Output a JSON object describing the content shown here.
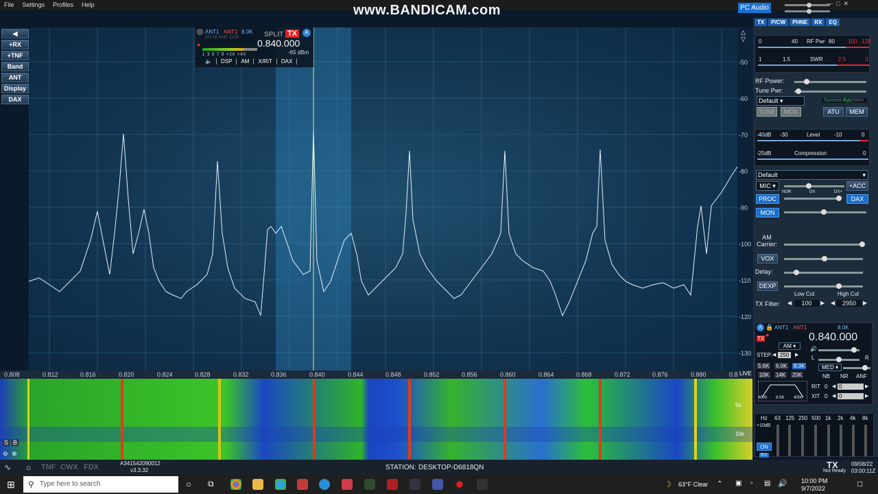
{
  "menu": [
    "File",
    "Settings",
    "Profiles",
    "Help"
  ],
  "watermark": "www.BANDICAM.com",
  "pc_audio": "PC Audio",
  "left_buttons": [
    "+RX",
    "+TNF",
    "Band",
    "ANT",
    "Display",
    "DAX"
  ],
  "slice": {
    "ant_rx": "ANT1",
    "ant_tx": "ANT1",
    "bandwidth": "8.0K",
    "split": "SPLIT",
    "tx": "TX",
    "letter": "A",
    "call": "N3 NI ANF QSK",
    "frequency": "0.840.000",
    "dbm": "-65 dBm",
    "smeter_scale": "1 3 5 7 9 +20 +40",
    "tabs": [
      "DSP",
      "AM",
      "X/RIT",
      "DAX"
    ]
  },
  "db_labels": [
    "-50",
    "-60",
    "-70",
    "-80",
    "-90",
    "-100",
    "-110",
    "-120",
    "-130"
  ],
  "freq_labels": [
    "0.808",
    "0.812",
    "0.816",
    "0.820",
    "0.824",
    "0.828",
    "0.832",
    "0.836",
    "0.840",
    "0.844",
    "0.848",
    "0.852",
    "0.856",
    "0.860",
    "0.864",
    "0.868",
    "0.872",
    "0.876",
    "0.880",
    "0.8"
  ],
  "live": "LIVE",
  "wf_labels": [
    "5s",
    "10s"
  ],
  "right": {
    "tabs": [
      "TX",
      "P/CW",
      "PHNE",
      "RX",
      "EQ"
    ],
    "rfpwr_scale": [
      "0",
      "40",
      "RF Pwr",
      "80",
      "100",
      "120"
    ],
    "swr_scale": [
      "1",
      "1.5",
      "SWR",
      "2.5",
      "3"
    ],
    "rf_power": "RF Power:",
    "tune_pwr": "Tune Pwr:",
    "profile": "Default",
    "tune": "TUNE",
    "mox": "MOX",
    "success": "Success",
    "byp": "Byp",
    "mem_small": "Mem",
    "atu": "ATU",
    "mem": "MEM",
    "level_scale": [
      "-40dB",
      "-30",
      "Level",
      "-10",
      "0"
    ],
    "comp_scale": [
      "-25dB",
      "Compression",
      "0"
    ],
    "mic_profile": "Default",
    "mic": "MIC",
    "acc": "+ACC",
    "proc": "PROC",
    "nor": "NOR",
    "dx": "DX",
    "dxplus": "DX+",
    "dax": "DAX",
    "mon": "MON",
    "am_carrier": "AM Carrier:",
    "vox": "VOX",
    "delay": "Delay:",
    "dexp": "DEXP",
    "low_cut": "Low Cut",
    "high_cut": "High Cut",
    "tx_filter": "TX Filter:",
    "low_val": "100",
    "high_val": "2950",
    "slice_ant": "ANT1",
    "slice_ant2": "ANT1",
    "slice_bw": "8.0K",
    "slice_freq": "0.840.000",
    "mode": "AM",
    "step_label": "STEP:",
    "step": "250",
    "filters": [
      "5.6K",
      "6.0K",
      "8.0K",
      "10K",
      "14K",
      "20K"
    ],
    "agc": "MED",
    "nb": "NB",
    "nr": "NR",
    "anf": "ANF",
    "rit": "RIT",
    "xit": "XIT",
    "rit_val": "0",
    "xit_val": "0",
    "filt_lo": "4000",
    "filt_mid": "8.0K",
    "filt_hi": "4000",
    "eq_hz": [
      "Hz",
      "63",
      "125",
      "250",
      "500",
      "1k",
      "2k",
      "4k",
      "8k"
    ],
    "eq_gain": "+10dB",
    "eq_on": "ON",
    "eq_rx": "RX"
  },
  "status": {
    "tnf": "TNF",
    "cwx": "CWX",
    "fdx": "FDX",
    "serial": "A341542090012",
    "version": "v3.3.32",
    "station_label": "STATION:",
    "station": "DESKTOP-D6818QN",
    "tx": "TX",
    "not_ready": "Not Ready",
    "date": "09/08/22",
    "utc": "03:00:11Z"
  },
  "taskbar": {
    "search": "Type here to search",
    "weather": "63°F  Clear",
    "time": "10:00 PM",
    "date": "9/7/2022"
  }
}
